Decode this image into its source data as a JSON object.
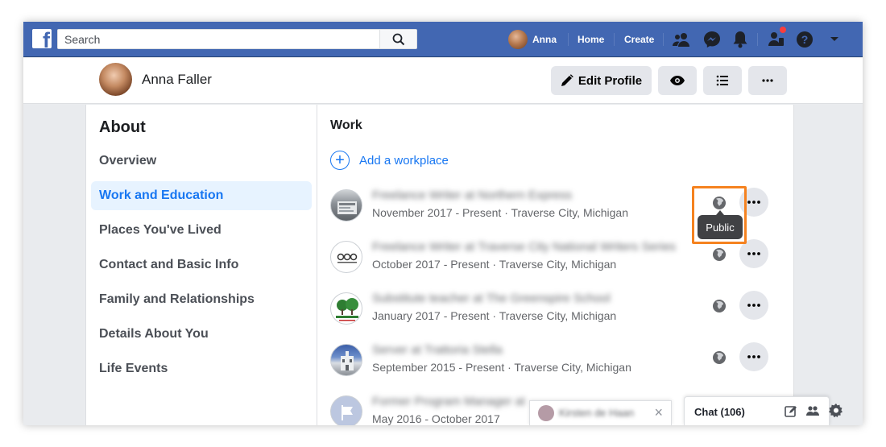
{
  "topbar": {
    "search_placeholder": "Search",
    "user_name": "Anna",
    "home_label": "Home",
    "create_label": "Create"
  },
  "profile": {
    "name": "Anna Faller",
    "edit_profile_label": "Edit Profile"
  },
  "about": {
    "title": "About",
    "menu": [
      {
        "label": "Overview",
        "active": false
      },
      {
        "label": "Work and Education",
        "active": true
      },
      {
        "label": "Places You've Lived",
        "active": false
      },
      {
        "label": "Contact and Basic Info",
        "active": false
      },
      {
        "label": "Family and Relationships",
        "active": false
      },
      {
        "label": "Details About You",
        "active": false
      },
      {
        "label": "Life Events",
        "active": false
      }
    ]
  },
  "work": {
    "title": "Work",
    "add_label": "Add a workplace",
    "jobs": [
      {
        "title": "Freelance Writer at Northern Express",
        "meta": "November 2017 - Present · Traverse City, Michigan"
      },
      {
        "title": "Freelance Writer at Traverse City National Writers Series",
        "meta": "October 2017 - Present · Traverse City, Michigan"
      },
      {
        "title": "Substitute teacher at The Greenspire School",
        "meta": "January 2017 - Present · Traverse City, Michigan"
      },
      {
        "title": "Server at Trattoria Stella",
        "meta": "September 2015 - Present · Traverse City, Michigan"
      },
      {
        "title": "Former Program Manager at",
        "meta": "May 2016 - October 2017"
      }
    ]
  },
  "tooltip": {
    "label": "Public"
  },
  "chat": {
    "label": "Chat (106)",
    "popup_name": "Kirsten de Haan"
  },
  "colors": {
    "brand": "#4267b2",
    "accent": "#1877f2",
    "highlight": "#f5821f",
    "notification": "#fa3e3e"
  }
}
